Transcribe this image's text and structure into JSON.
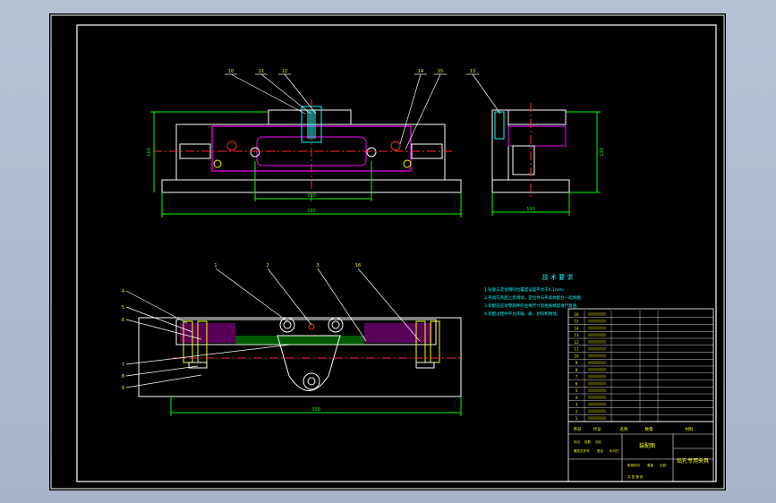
{
  "sheet": {
    "background": "#000000",
    "frame_color": "#ffffff"
  },
  "colors": {
    "outline": "#ffffff",
    "dimension": "#00ff00",
    "center_line": "#ff2a2a",
    "part": "#ff00ff",
    "leader": "#ffffff",
    "text": "#00ffff",
    "hatch": "#ff00ff",
    "yellow": "#ffff00"
  },
  "top_view": {
    "balloons": [
      "10",
      "11",
      "12",
      "14",
      "15"
    ],
    "dimensions": {
      "width": "290",
      "inner": "180",
      "height": "160"
    }
  },
  "side_view": {
    "balloons": [
      "13"
    ],
    "dimensions": {
      "width": "110",
      "height": "130"
    }
  },
  "front_view": {
    "balloons_top": [
      "1",
      "2",
      "3",
      "16"
    ],
    "balloons_left": [
      "4",
      "5",
      "6",
      "7",
      "8",
      "9"
    ],
    "dimensions": {
      "width": "350"
    }
  },
  "tech_req": {
    "title": "技 术 要 求",
    "items": [
      "1.钻套与定位销的位置度误差不大于0.1mm;",
      "2.夹具在装配上后调试，定位件与夹具体配合一起修磨;",
      "3.装配前应对零部件的主要尺寸及相关精度进行复查;",
      "4.装配过程中不允许磕、碰、划伤和锈蚀。"
    ]
  },
  "title_block": {
    "part_rows": [
      "16",
      "15",
      "14",
      "13",
      "12",
      "11",
      "10",
      "9",
      "8",
      "7",
      "6",
      "5",
      "4",
      "3",
      "2",
      "1"
    ],
    "header": [
      "序号",
      "代号",
      "名称",
      "数量",
      "材料"
    ],
    "drawing_name": "装配图",
    "product_name": "钻孔专用夹具",
    "sign_labels": [
      "标记",
      "处数",
      "分区",
      "更改文件号",
      "签名",
      "年月日"
    ],
    "stage_labels": [
      "阶段标记",
      "重量",
      "比例"
    ],
    "footer": "共 张  第 张"
  }
}
